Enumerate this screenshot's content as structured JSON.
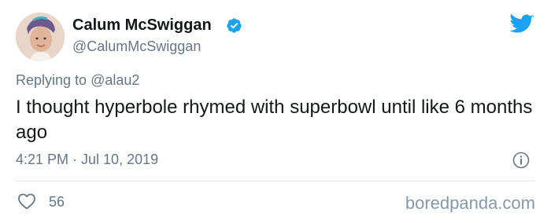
{
  "author": {
    "display_name": "Calum McSwiggan",
    "handle": "@CalumMcSwiggan",
    "verified": true
  },
  "reply": {
    "prefix": "Replying to",
    "target": "@alau2"
  },
  "tweet": {
    "text": "I thought hyperbole rhymed with superbowl until like 6 months ago",
    "timestamp": "4:21 PM · Jul 10, 2019"
  },
  "engagement": {
    "likes": "56"
  },
  "watermark": "boredpanda.com",
  "colors": {
    "verified_blue": "#1da1f2",
    "twitter_blue": "#1da1f2",
    "secondary_text": "#657786",
    "primary_text": "#14171a"
  },
  "icons": {
    "verified": "verified-badge-icon",
    "brand": "twitter-bird-icon",
    "info": "info-icon",
    "like": "heart-icon"
  }
}
